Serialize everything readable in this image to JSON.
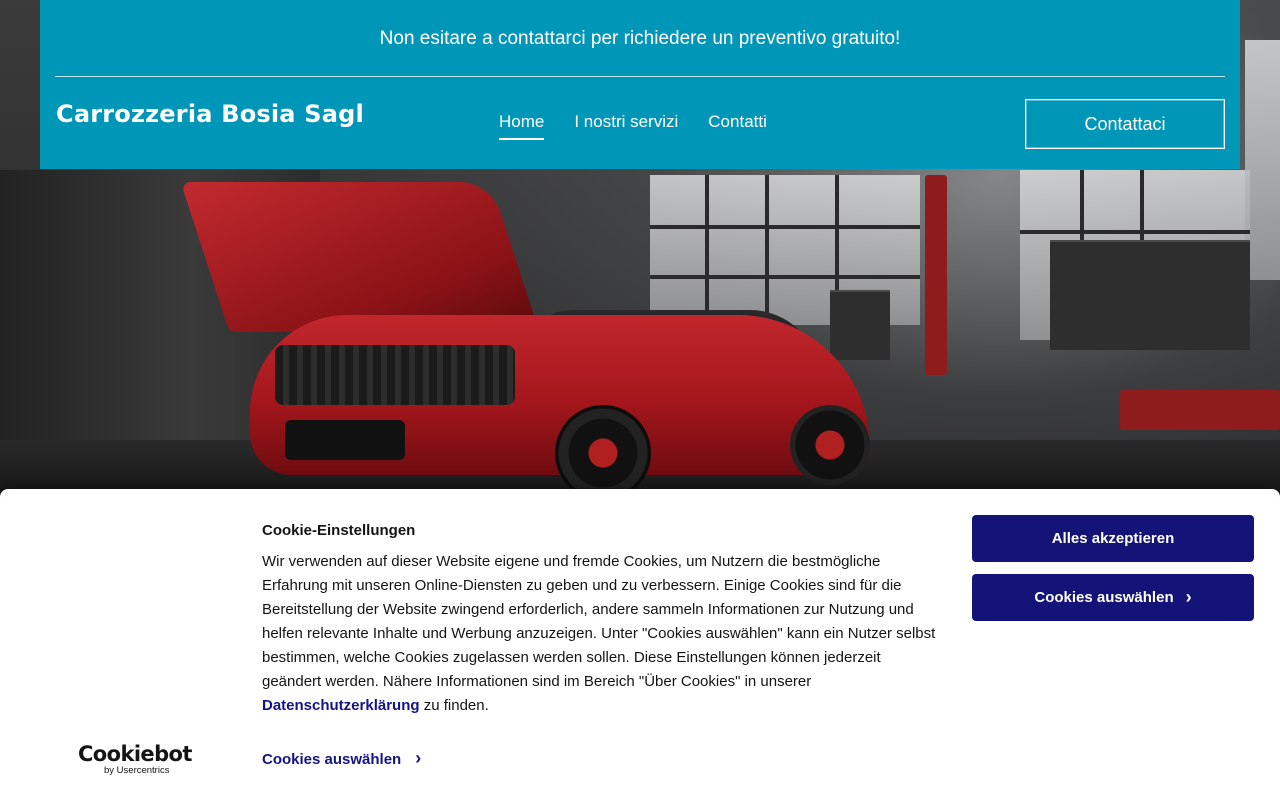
{
  "topbar": {
    "text": "Non esitare a contattarci per richiedere un preventivo gratuito!"
  },
  "header": {
    "brand": "Carrozzeria Bosia Sagl",
    "nav": [
      {
        "label": "Home",
        "active": true
      },
      {
        "label": "I nostri servizi",
        "active": false
      },
      {
        "label": "Contatti",
        "active": false
      }
    ],
    "cta_label": "Contattaci"
  },
  "cookie": {
    "title": "Cookie-Einstellungen",
    "body_before_link": "Wir verwenden auf dieser Website eigene und fremde Cookies, um Nutzern die bestmögliche Erfahrung mit unseren Online-Diensten zu geben und zu verbessern. Einige Cookies sind für die Bereitstellung der Website zwingend erforderlich, andere sammeln Informationen zur Nutzung und helfen relevante Inhalte und Werbung anzuzeigen. Unter \"Cookies auswählen\" kann ein Nutzer selbst bestimmen, welche Cookies zugelassen werden sollen. Diese Einstellungen können jederzeit geändert werden. Nähere Informationen sind im Bereich \"Über Cookies\" in unserer ",
    "link_text": "Datenschutzerklärung",
    "body_after_link": " zu finden.",
    "accept_all_label": "Alles akzeptieren",
    "select_cookies_label": "Cookies auswählen",
    "select_cookies_link_label": "Cookies auswählen",
    "chevron_icon": "chevron-right-icon",
    "logo_text": "Cookiebot",
    "logo_sub": "by Usercentrics"
  },
  "colors": {
    "header_bg": "#0096b8",
    "cookie_button_bg": "#141478",
    "cookie_link": "#14148a"
  }
}
